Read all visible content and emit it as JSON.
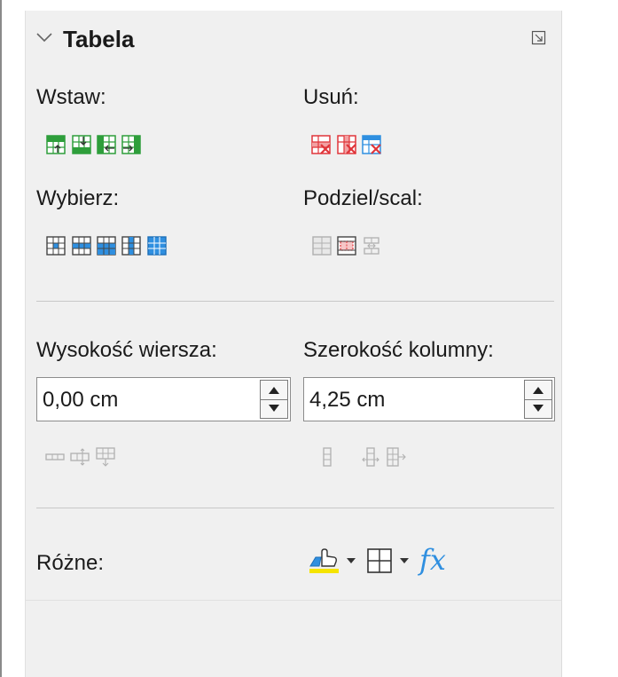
{
  "panel": {
    "title": "Tabela",
    "icons": {
      "collapse": "chevron-down-icon",
      "more_options": "more-options-icon"
    }
  },
  "insert": {
    "label": "Wstaw:",
    "buttons": [
      "insert-rows-above-icon",
      "insert-rows-below-icon",
      "insert-columns-before-icon",
      "insert-columns-after-icon"
    ]
  },
  "delete": {
    "label": "Usuń:",
    "buttons": [
      "delete-rows-icon",
      "delete-columns-icon",
      "delete-table-icon"
    ]
  },
  "select": {
    "label": "Wybierz:",
    "buttons": [
      "select-cell-icon",
      "select-row-icon",
      "select-column-icon",
      "select-table-icon"
    ]
  },
  "split_merge": {
    "label": "Podziel/scal:",
    "buttons": [
      "split-cells-icon",
      "merge-cells-icon",
      "split-table-icon"
    ]
  },
  "row_height": {
    "label": "Wysokość wiersza:",
    "value": "0,00 cm",
    "buttons": [
      "minimal-row-height-icon",
      "optimal-row-height-icon",
      "distribute-rows-icon"
    ]
  },
  "column_width": {
    "label": "Szerokość kolumny:",
    "value": "4,25 cm",
    "buttons": [
      "minimal-column-width-icon",
      "optimal-column-width-icon",
      "distribute-columns-icon"
    ]
  },
  "misc": {
    "label": "Różne:",
    "buttons": [
      "cell-background-color-icon",
      "borders-icon",
      "formula-icon"
    ],
    "formula_glyph": "fx"
  },
  "colors": {
    "panel_bg": "#f0f0f0",
    "green_grid": "#2e9e3b",
    "red_delete": "#e0353a",
    "blue_select": "#2f8fe0",
    "disabled": "#b0b0b0",
    "highlight_yellow": "#f5e400"
  }
}
